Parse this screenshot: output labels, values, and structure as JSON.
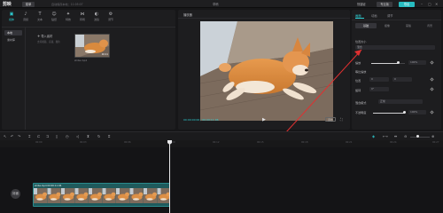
{
  "app": {
    "logo": "剪映",
    "menu_label": "菜单",
    "autosave": "自动保存本地：11:05:07",
    "window_title": "草稿",
    "shortcut": "快捷键",
    "pro_label": "专业版",
    "export_label": "导出"
  },
  "media_toolbar": [
    {
      "icon": "media-icon",
      "label": "媒体",
      "active": true
    },
    {
      "icon": "audio-icon",
      "label": "音频",
      "active": false
    },
    {
      "icon": "text-icon",
      "label": "文本",
      "active": false
    },
    {
      "icon": "sticker-icon",
      "label": "贴纸",
      "active": false
    },
    {
      "icon": "effects-icon",
      "label": "特效",
      "active": false
    },
    {
      "icon": "transition-icon",
      "label": "转场",
      "active": false
    },
    {
      "icon": "filter-icon",
      "label": "滤镜",
      "active": false
    },
    {
      "icon": "adjust-icon",
      "label": "调节",
      "active": false
    }
  ],
  "media_sidebar": [
    {
      "label": "本地",
      "active": true
    },
    {
      "label": "素材库",
      "active": false
    }
  ],
  "media": {
    "import_label": "导入素材",
    "import_hint": "支持视频、音频、图片",
    "thumb_duration": "00:11",
    "thumb_name": "shiba.mp4"
  },
  "player": {
    "title": "播放器",
    "timecode": "00:00:00:00 / 00:00:11:06",
    "ratio_label": "原始"
  },
  "props": {
    "tabs": [
      "画面",
      "动画",
      "调节"
    ],
    "active_tab_index": 0,
    "subtabs": [
      "基础",
      "抠像",
      "蒙版",
      "背景"
    ],
    "active_subtab_index": 0,
    "sections": {
      "position_size": "位置大小",
      "blend": "混合",
      "scale": "缩放",
      "scale_value": "100%",
      "uniform_scale": "等比缩放",
      "position": "位置",
      "pos_x": "0",
      "pos_y": "0",
      "rotate": "旋转",
      "rotate_value": "0°",
      "mix_mode": "混合模式",
      "mix_value": "正常",
      "opacity": "不透明度",
      "opacity_value": "100%"
    }
  },
  "timeline": {
    "ruler": [
      "00:00",
      "00:03",
      "00:06",
      "00:09",
      "00:12",
      "00:15",
      "00:18",
      "00:21",
      "00:24",
      "00:27"
    ],
    "cover_label": "封面",
    "clip_label": "shiba.mp4  00:00:11:06"
  }
}
